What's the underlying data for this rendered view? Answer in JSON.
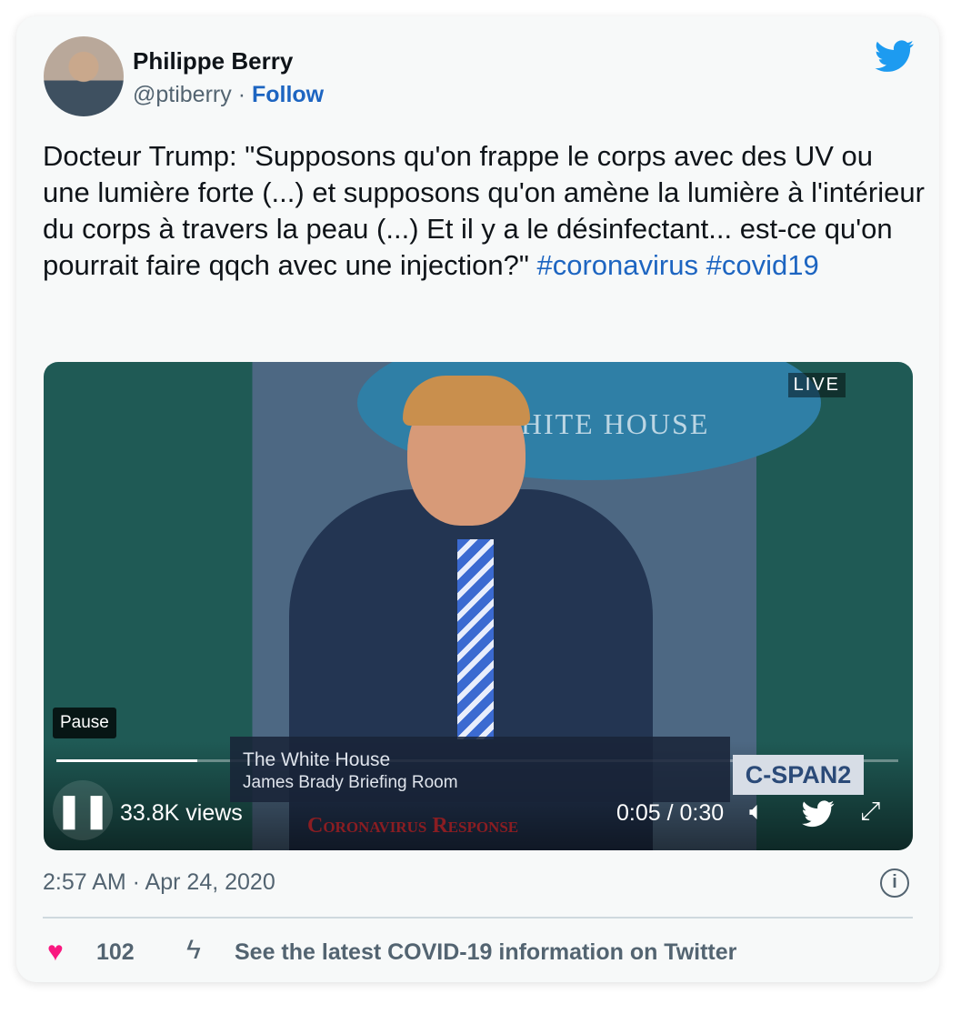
{
  "author": {
    "name": "Philippe Berry",
    "handle": "@ptiberry",
    "separator": " · ",
    "follow_label": "Follow"
  },
  "tweet": {
    "text": "Docteur Trump: \"Supposons qu'on frappe le corps avec des UV ou une lumière forte (...) et supposons qu'on amène la lumière à l'intérieur du corps à travers la peau (...) Et il y a le désinfectant... est-ce qu'on pourrait faire qqch avec une injection?\" ",
    "hashtags": [
      "#coronavirus",
      "#covid19"
    ]
  },
  "video": {
    "live_badge": "LIVE",
    "seal_text": "THE WHITE HOUSE",
    "lower_third_title": "The White House",
    "lower_third_subtitle": "James Brady Briefing Room",
    "network": "C-SPAN2",
    "banner": "Coronavirus Response",
    "tooltip": "Pause",
    "views": "33.8K views",
    "current_time": "0:05",
    "duration": "0:30",
    "time_sep": " / ",
    "progress_fraction": 0.167
  },
  "timestamp": "2:57 AM · Apr 24, 2020",
  "footer": {
    "likes": "102",
    "covid_link": "See the latest COVID-19 information on Twitter"
  },
  "colors": {
    "link": "#1d65c1",
    "heart": "#f91880",
    "twitter": "#1d9bf0"
  }
}
